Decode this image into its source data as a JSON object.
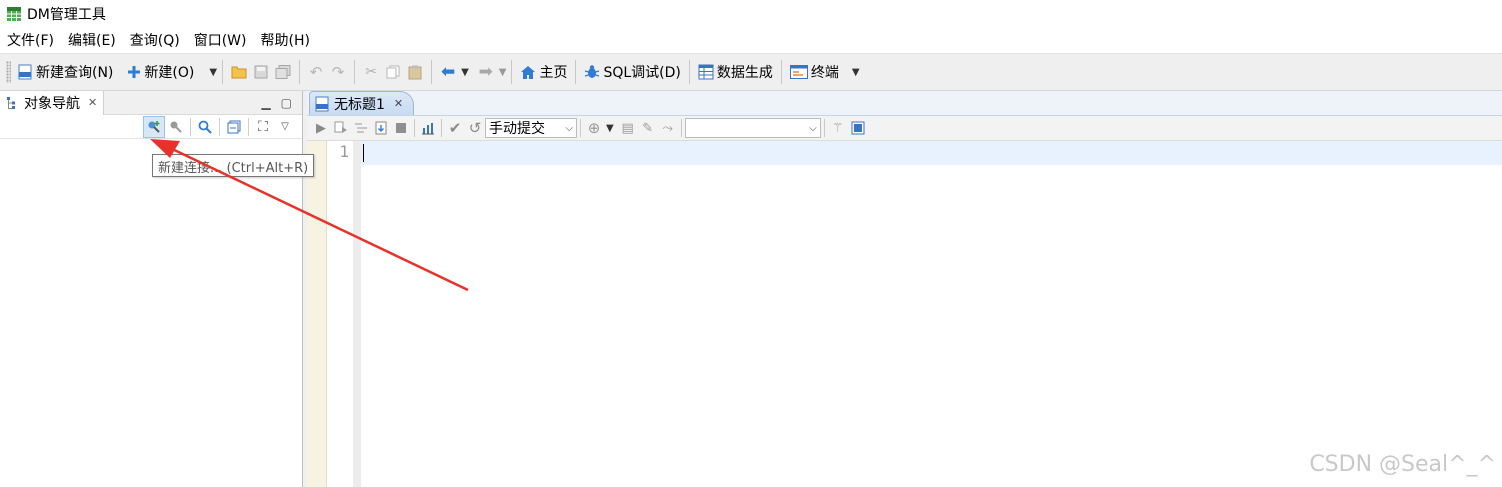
{
  "window": {
    "title": "DM管理工具"
  },
  "menu": [
    "文件(F)",
    "编辑(E)",
    "查询(Q)",
    "窗口(W)",
    "帮助(H)"
  ],
  "toolbar": {
    "new_query": "新建查询(N)",
    "new": "新建(O)",
    "home": "主页",
    "sql_debug": "SQL调试(D)",
    "data_gen": "数据生成",
    "terminal": "终端"
  },
  "left_panel": {
    "tab_label": "对象导航",
    "tooltip": "新建连接... (Ctrl+Alt+R)"
  },
  "editor": {
    "tab_label": "无标题1",
    "commit_mode": "手动提交",
    "db_select": "",
    "line_number": "1"
  },
  "watermark": "CSDN @Seal^_^",
  "colors": {
    "accent_blue": "#2f7cd6",
    "arrow_red": "#e8312a"
  }
}
